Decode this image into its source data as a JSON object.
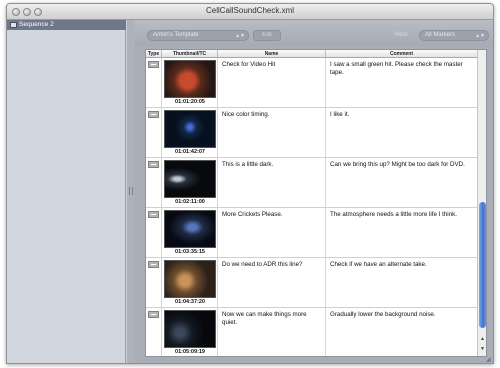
{
  "window": {
    "title": "CellCallSoundCheck.xml"
  },
  "sidebar": {
    "items": [
      {
        "label": "Sequence 2"
      }
    ]
  },
  "toolbar": {
    "template_select": "Anton's Template",
    "edit_label": "Edit",
    "view_label": "View:",
    "view_select": "All Markers"
  },
  "table": {
    "columns": [
      "Type",
      "Thumbnail/TC",
      "Name",
      "Comment"
    ],
    "rows": [
      {
        "timecode": "01:01:20:05",
        "name": "Check for Video Hit",
        "comment": "I saw a small green hit. Please check the master tape."
      },
      {
        "timecode": "01:01:42:07",
        "name": "Nice color timing.",
        "comment": "I like it."
      },
      {
        "timecode": "01:02:11:00",
        "name": "This is a little dark.",
        "comment": "Can we bring this up? Might be too dark for DVD."
      },
      {
        "timecode": "01:03:35:15",
        "name": "More Crickets Please.",
        "comment": "The atmosphere needs a little more life I think."
      },
      {
        "timecode": "01:04:37:20",
        "name": "Do we need to ADR this line?",
        "comment": "Check if we have an alternate take."
      },
      {
        "timecode": "01:05:09:19",
        "name": "Now we can make things more quiet.",
        "comment": "Gradually lower the background noise."
      }
    ]
  },
  "colors": {
    "selection": "#6f7789",
    "scroll_thumb": "#3f74d1"
  }
}
